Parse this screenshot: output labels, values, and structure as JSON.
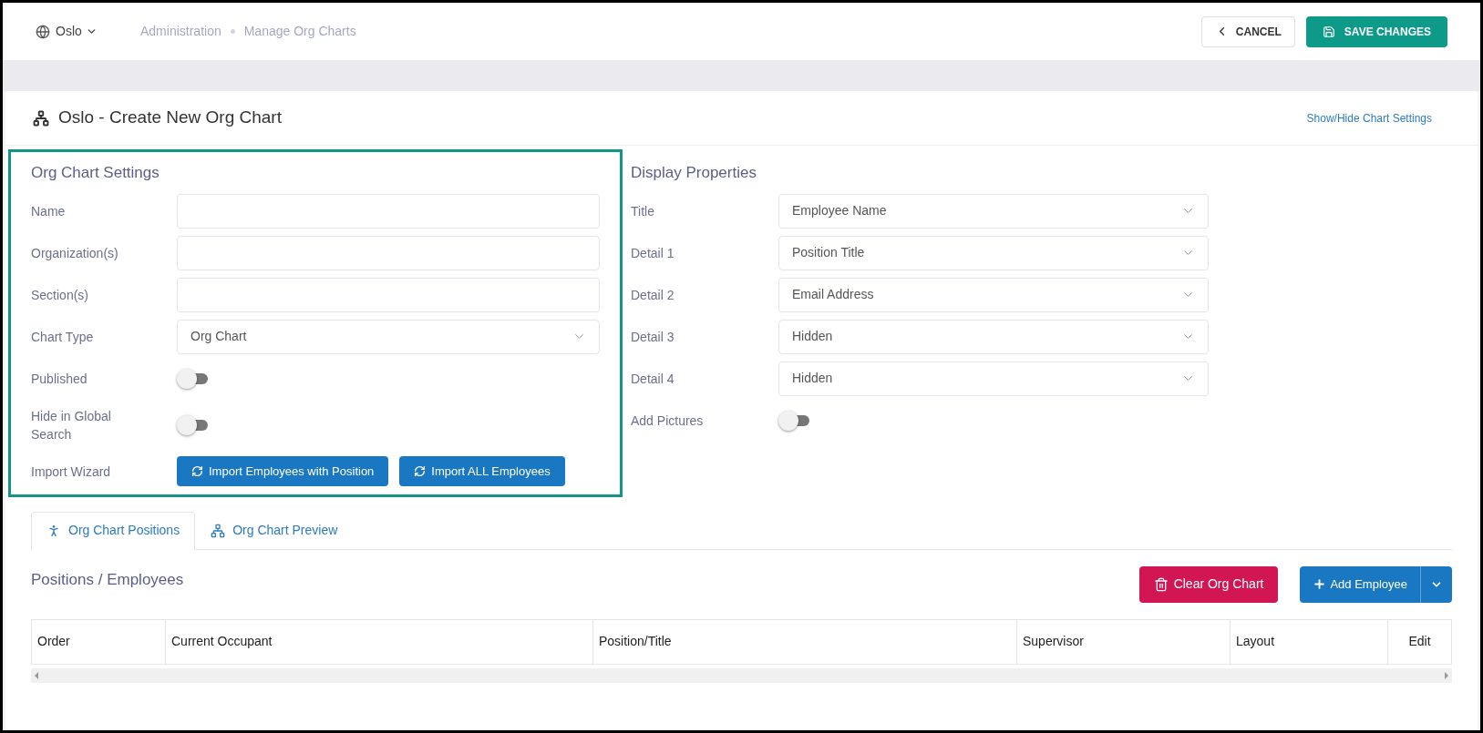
{
  "header": {
    "location": "Oslo",
    "breadcrumbs": [
      "Administration",
      "Manage Org Charts"
    ],
    "cancel": "CANCEL",
    "save": "SAVE CHANGES"
  },
  "page": {
    "title": "Oslo - Create New Org Chart",
    "toggle_link": "Show/Hide Chart Settings"
  },
  "settings": {
    "heading": "Org Chart Settings",
    "fields": [
      {
        "kind": "input",
        "label": "Name"
      },
      {
        "kind": "input",
        "label": "Organization(s)"
      },
      {
        "kind": "input",
        "label": "Section(s)"
      },
      {
        "kind": "select",
        "label": "Chart Type",
        "value": "Org Chart"
      },
      {
        "kind": "toggle",
        "label": "Published",
        "on": false
      },
      {
        "kind": "toggle",
        "label": "Hide in Global Search",
        "on": false
      },
      {
        "kind": "buttons",
        "label": "Import Wizard",
        "buttons": [
          "Import Employees with Position",
          "Import ALL Employees"
        ]
      }
    ]
  },
  "display": {
    "heading": "Display Properties",
    "fields": [
      {
        "kind": "select",
        "label": "Title",
        "value": "Employee Name"
      },
      {
        "kind": "select",
        "label": "Detail 1",
        "value": "Position Title"
      },
      {
        "kind": "select",
        "label": "Detail 2",
        "value": "Email Address"
      },
      {
        "kind": "select",
        "label": "Detail 3",
        "value": "Hidden"
      },
      {
        "kind": "select",
        "label": "Detail 4",
        "value": "Hidden"
      },
      {
        "kind": "toggle",
        "label": "Add Pictures",
        "on": false
      }
    ]
  },
  "tabs": [
    {
      "label": "Org Chart Positions",
      "selected": true
    },
    {
      "label": "Org Chart Preview",
      "selected": false
    }
  ],
  "positions": {
    "heading": "Positions / Employees",
    "clear": "Clear Org Chart",
    "add": "Add Employee"
  },
  "table": {
    "columns": [
      "Order",
      "Current Occupant",
      "Position/Title",
      "Supervisor",
      "Layout",
      "Edit"
    ]
  }
}
